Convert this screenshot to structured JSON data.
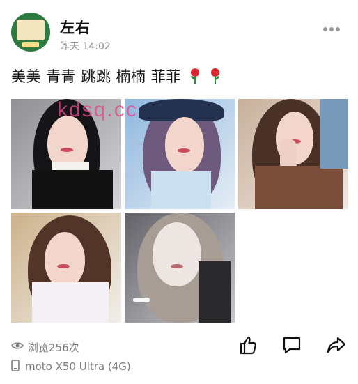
{
  "post": {
    "author": "左右",
    "time": "昨天 14:02",
    "caption": "美美 青青 跳跳 楠楠 菲菲",
    "caption_emoji": [
      "rose-icon",
      "rose-icon"
    ],
    "watermark": "kdsq.cc",
    "views": "浏览256次",
    "device": "moto X50 Ultra (4G)"
  },
  "icons": {
    "more": "more-icon",
    "eye": "eye-icon",
    "phone": "phone-icon",
    "like": "thumbs-up-icon",
    "comment": "comment-icon",
    "share": "share-icon"
  },
  "colors": {
    "watermark": "#e24a8c",
    "muted": "#7c7c7c",
    "avatar_bg": "#2f7a40"
  }
}
